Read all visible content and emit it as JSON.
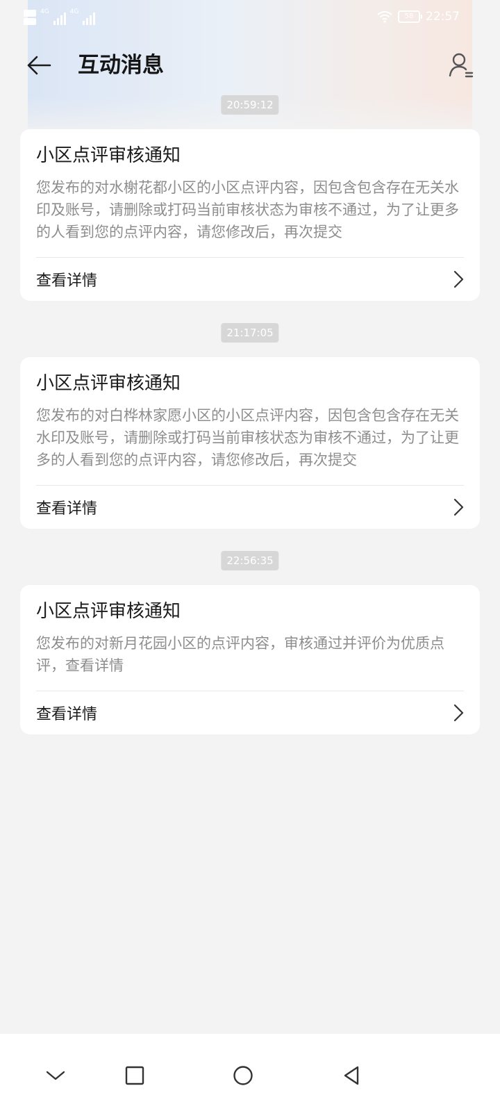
{
  "status_bar": {
    "network_1": "4G",
    "network_2": "4G",
    "battery": "58",
    "time": "22:57"
  },
  "header": {
    "title": "互动消息"
  },
  "messages": [
    {
      "time": "20:59:12",
      "title": "小区点评审核通知",
      "body": "您发布的对水榭花都小区的小区点评内容，因包含包含存在无关水印及账号，请删除或打码当前审核状态为审核不通过，为了让更多的人看到您的点评内容，请您修改后，再次提交",
      "action": "查看详情"
    },
    {
      "time": "21:17:05",
      "title": "小区点评审核通知",
      "body": "您发布的对白桦林家愿小区的小区点评内容，因包含包含存在无关水印及账号，请删除或打码当前审核状态为审核不通过，为了让更多的人看到您的点评内容，请您修改后，再次提交",
      "action": "查看详情"
    },
    {
      "time": "22:56:35",
      "title": "小区点评审核通知",
      "body": "您发布的对新月花园小区的点评内容，审核通过并评价为优质点评，查看详情",
      "action": "查看详情"
    }
  ],
  "icons": {
    "back": "arrow-left-icon",
    "user": "user-list-icon",
    "chevron": "chevron-right-icon",
    "nav_down": "chevron-down-icon",
    "nav_recent": "square-icon",
    "nav_home": "circle-icon",
    "nav_back": "triangle-back-icon"
  }
}
